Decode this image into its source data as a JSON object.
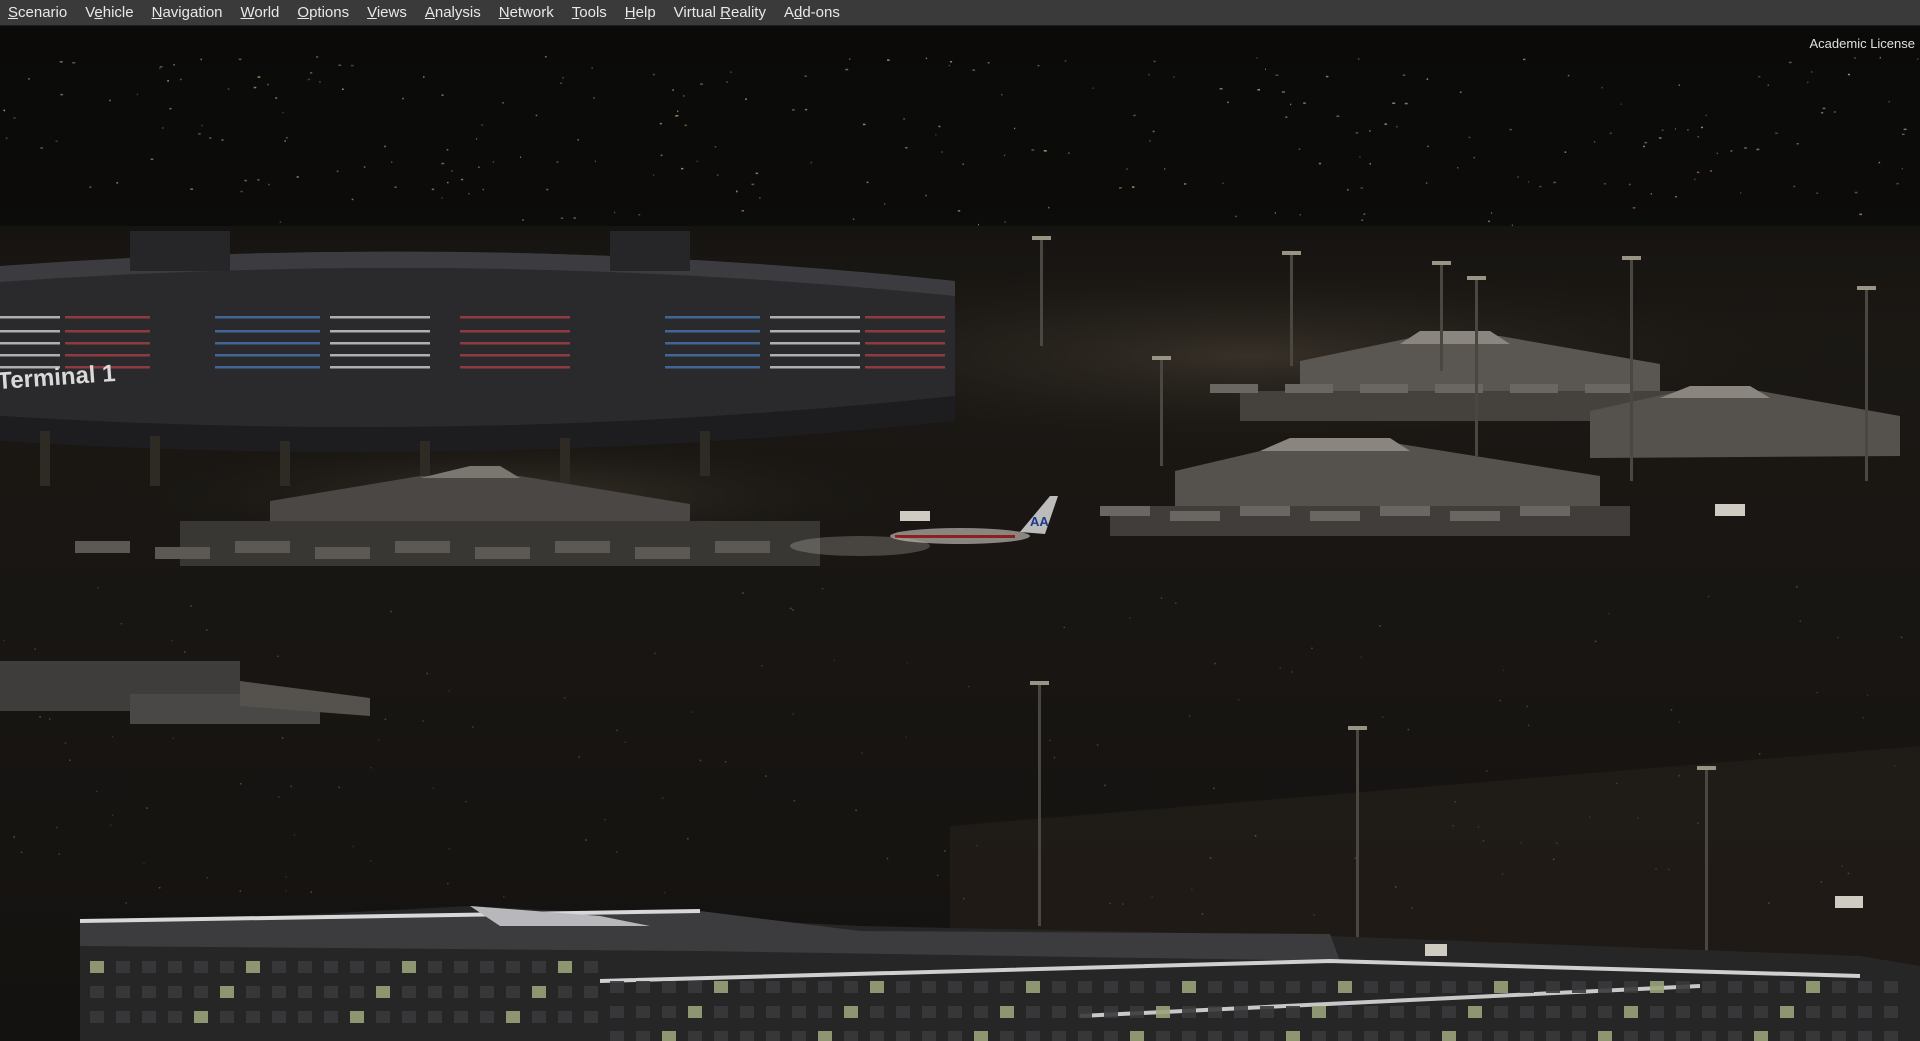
{
  "menu": [
    {
      "label": "Scenario",
      "accel": 0
    },
    {
      "label": "Vehicle",
      "accel": 1
    },
    {
      "label": "Navigation",
      "accel": 0
    },
    {
      "label": "World",
      "accel": 0
    },
    {
      "label": "Options",
      "accel": 0
    },
    {
      "label": "Views",
      "accel": 0
    },
    {
      "label": "Analysis",
      "accel": 0
    },
    {
      "label": "Network",
      "accel": 0
    },
    {
      "label": "Tools",
      "accel": 0
    },
    {
      "label": "Help",
      "accel": 0
    },
    {
      "label": "Virtual Reality",
      "accel": 8
    },
    {
      "label": "Add-ons",
      "accel": 1
    }
  ],
  "license": "Academic License",
  "scene": {
    "terminal_sign": "Terminal 1",
    "aircraft_tail": "AA"
  },
  "colors": {
    "menubar": "#3a3a3a",
    "sky": "#0b0a09",
    "ground": "#1c1915",
    "light_white": "#dcdcdc",
    "light_red": "#b0404a",
    "light_blue": "#4a7ab8"
  }
}
